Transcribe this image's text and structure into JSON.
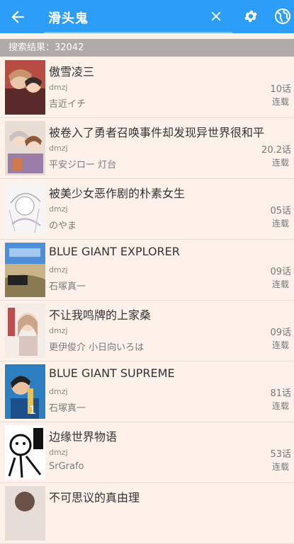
{
  "header": {
    "query": "滑头鬼",
    "accent": "#2d9ef7",
    "icons": [
      "back-arrow-icon",
      "clear-icon",
      "gear-icon",
      "globe-icon"
    ]
  },
  "results": {
    "summary": "搜索结果：32042"
  },
  "items": [
    {
      "title": "傲雪凌三",
      "source": "dmzj",
      "author": "吉近イチ",
      "chapters": "10话",
      "status": "连载"
    },
    {
      "title": "被卷入了勇者召唤事件却发现异世界很和平",
      "source": "dmzj",
      "author": "平安ジロー 灯台",
      "chapters": "20.2话",
      "status": "连载"
    },
    {
      "title": "被美少女恶作剧的朴素女生",
      "source": "dmzj",
      "author": "のやま",
      "chapters": "05话",
      "status": "连载"
    },
    {
      "title": "BLUE GIANT EXPLORER",
      "source": "dmzj",
      "author": "石塚真一",
      "chapters": "09话",
      "status": "连载"
    },
    {
      "title": "不让我鸣牌的上家桑",
      "source": "dmzj",
      "author": "更伊俊介 小日向いろは",
      "chapters": "09话",
      "status": "连载"
    },
    {
      "title": "BLUE GIANT SUPREME",
      "source": "dmzj",
      "author": "石塚真一",
      "chapters": "81话",
      "status": "连载"
    },
    {
      "title": "边缘世界物语",
      "source": "dmzj",
      "author": "SrGrafo",
      "chapters": "53话",
      "status": "连载"
    },
    {
      "title": "不可思议的真由理",
      "source": "",
      "author": "",
      "chapters": "",
      "status": ""
    }
  ]
}
